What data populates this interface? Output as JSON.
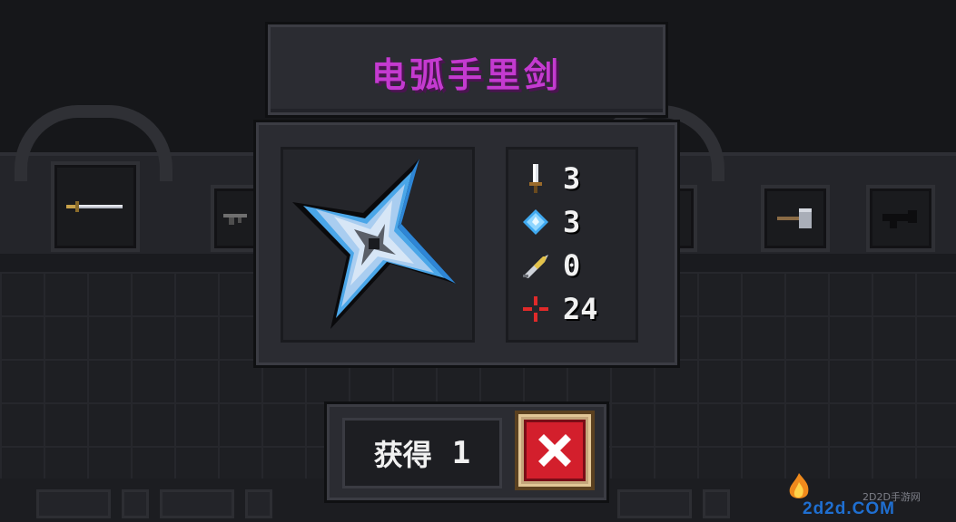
{
  "item": {
    "name": "电弧手里剑",
    "name_color": "#c43ad0",
    "icon": "shuriken-icon"
  },
  "stats": [
    {
      "icon": "sword-icon",
      "label": "damage",
      "value": "3"
    },
    {
      "icon": "crystal-icon",
      "label": "energy",
      "value": "3"
    },
    {
      "icon": "feather-icon",
      "label": "accuracy",
      "value": "0"
    },
    {
      "icon": "crosshair-icon",
      "label": "crit",
      "value": "24"
    }
  ],
  "obtain": {
    "label": "获得",
    "count": "1"
  },
  "close_icon": "close-icon",
  "watermark": {
    "sub": "2D2D手游网",
    "main": "2d2d.COM"
  },
  "colors": {
    "panel": "#2b2c32",
    "close_red": "#d31f2c",
    "close_frame": "#c4a57a"
  }
}
